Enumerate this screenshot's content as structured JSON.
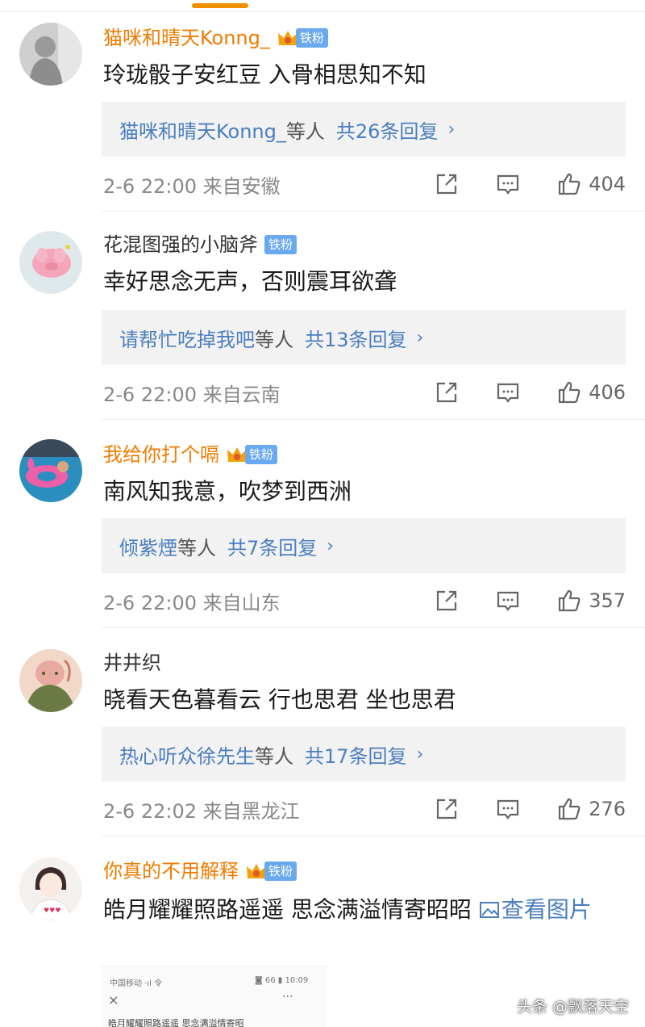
{
  "colors": {
    "accent_orange": "#f29100",
    "vip_name": "#f07b00",
    "link_blue": "#4a7ebf",
    "fan_tag_bg": "#6aa9f0",
    "reply_bg": "#f2f2f2"
  },
  "fan_tag_label": "铁粉",
  "comments": [
    {
      "username": "猫咪和晴天Konng_",
      "vip": true,
      "text": "玲珑骰子安红豆  入骨相思知不知",
      "replies_who": "猫咪和晴天Konng_",
      "replies_etc": "等人",
      "replies_count": "共26条回复",
      "replies_chevron": "›",
      "meta": "2-6 22:00 来自安徽",
      "likes": "404",
      "avatar_icon": "statue-avatar"
    },
    {
      "username": "花混图强的小脑斧",
      "vip": false,
      "text": "幸好思念无声，否则震耳欲聋",
      "replies_who": "请帮忙吃掉我吧",
      "replies_etc": "等人",
      "replies_count": "共13条回复",
      "replies_chevron": "›",
      "meta": "2-6 22:00 来自云南",
      "likes": "406",
      "avatar_icon": "pink-pig-avatar"
    },
    {
      "username": "我给你打个嗝",
      "vip": true,
      "text": "南风知我意，吹梦到西洲",
      "replies_who": "倾紫煙",
      "replies_etc": "等人",
      "replies_count": "共7条回复",
      "replies_chevron": "›",
      "meta": "2-6 22:00 来自山东",
      "likes": "357",
      "avatar_icon": "pool-float-avatar"
    },
    {
      "username": "井井织",
      "vip": false,
      "text": "晓看天色暮看云 行也思君 坐也思君",
      "replies_who": "热心听众徐先生",
      "replies_etc": "等人",
      "replies_count": "共17条回复",
      "replies_chevron": "›",
      "meta": "2-6 22:02 来自黑龙江",
      "likes": "276",
      "avatar_icon": "illustration-avatar"
    },
    {
      "username": "你真的不用解释",
      "vip": true,
      "text": "皓月耀耀照路遥遥 思念满溢情寄昭昭 ",
      "view_image_link": "查看图片",
      "avatar_icon": "girl-sketch-avatar"
    }
  ],
  "preview": {
    "status_left": "中国移动 ·ıl 令",
    "status_right": "◙ 66 ▮ 10:09",
    "close": "×",
    "more": "···",
    "text": "皓月耀耀照路遥遥 思念满溢情寄昭"
  },
  "watermark": "头条 @飘落天空"
}
